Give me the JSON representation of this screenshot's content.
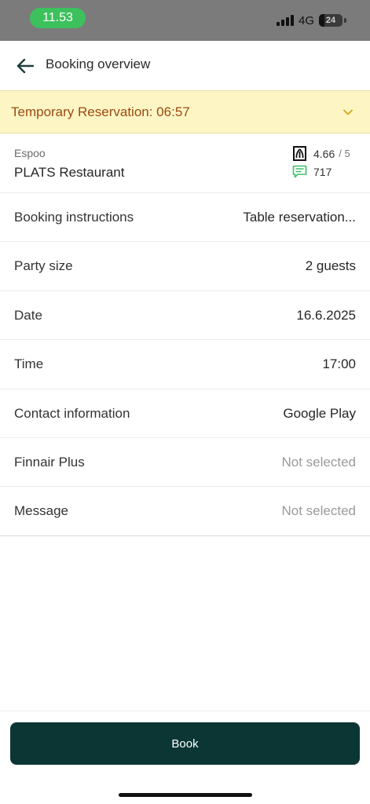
{
  "status_bar": {
    "time": "11.53",
    "network": "4G",
    "battery": "24"
  },
  "header": {
    "title": "Booking overview",
    "back_icon": "arrow-left-icon"
  },
  "banner": {
    "text": "Temporary Reservation: 06:57",
    "icon": "chevron-down-icon",
    "color": "#9a4a12",
    "background": "#fdf6c4"
  },
  "restaurant": {
    "city": "Espoo",
    "name": "PLATS Restaurant",
    "rating": "4.66",
    "rating_max": "/ 5",
    "reviews": "717",
    "rating_icon": "rating-badge-icon",
    "reviews_icon": "chat-bubble-icon"
  },
  "details": [
    {
      "label": "Booking instructions",
      "value": "Table reservation..."
    },
    {
      "label": "Party size",
      "value": "2 guests"
    },
    {
      "label": "Date",
      "value": "16.6.2025"
    },
    {
      "label": "Time",
      "value": "17:00"
    },
    {
      "label": "Contact information",
      "value": "Google Play"
    },
    {
      "label": "Finnair Plus",
      "value": "Not selected"
    },
    {
      "label": "Message",
      "value": "Not selected"
    }
  ],
  "footer": {
    "book_label": "Book",
    "button_color": "#0b3634"
  }
}
